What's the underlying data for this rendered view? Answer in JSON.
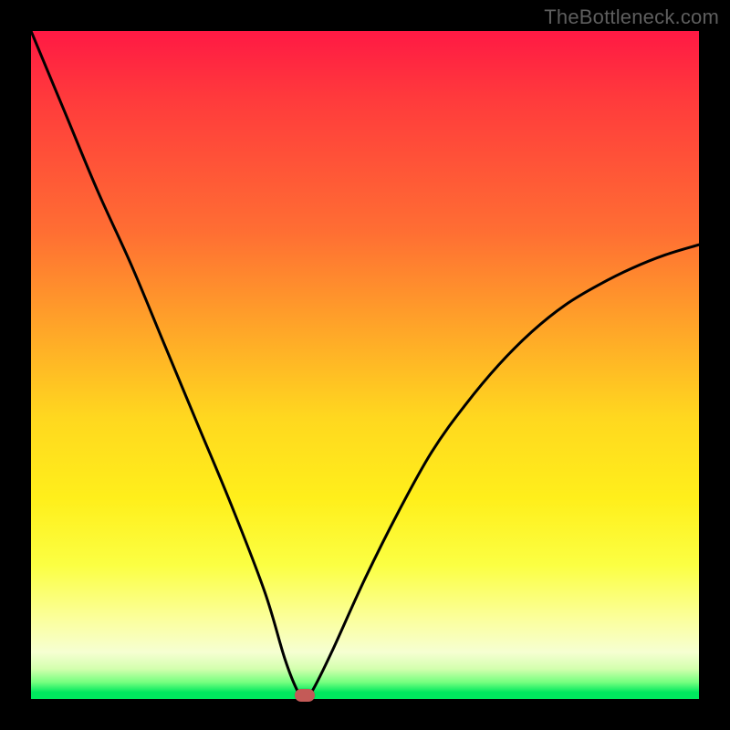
{
  "watermark": "TheBottleneck.com",
  "chart_data": {
    "type": "line",
    "title": "",
    "xlabel": "",
    "ylabel": "",
    "xlim": [
      0,
      100
    ],
    "ylim": [
      0,
      100
    ],
    "series": [
      {
        "name": "curve",
        "x": [
          0,
          5,
          10,
          15,
          20,
          25,
          30,
          35,
          38,
          40,
          41,
          42,
          45,
          50,
          55,
          60,
          65,
          70,
          75,
          80,
          85,
          90,
          95,
          100
        ],
        "y": [
          100,
          88,
          76,
          65,
          53,
          41,
          29,
          16,
          6,
          1,
          0.2,
          1,
          7,
          18,
          28,
          37,
          44,
          50,
          55,
          59,
          62,
          64.5,
          66.5,
          68
        ]
      }
    ],
    "minimum_marker": {
      "x": 41,
      "y": 0
    },
    "background_gradient": {
      "type": "vertical",
      "stops": [
        {
          "pos": 0.0,
          "color": "#ff1944"
        },
        {
          "pos": 0.45,
          "color": "#ffa728"
        },
        {
          "pos": 0.7,
          "color": "#ffef1b"
        },
        {
          "pos": 0.97,
          "color": "#75ff7f"
        },
        {
          "pos": 1.0,
          "color": "#00e85e"
        }
      ]
    }
  }
}
